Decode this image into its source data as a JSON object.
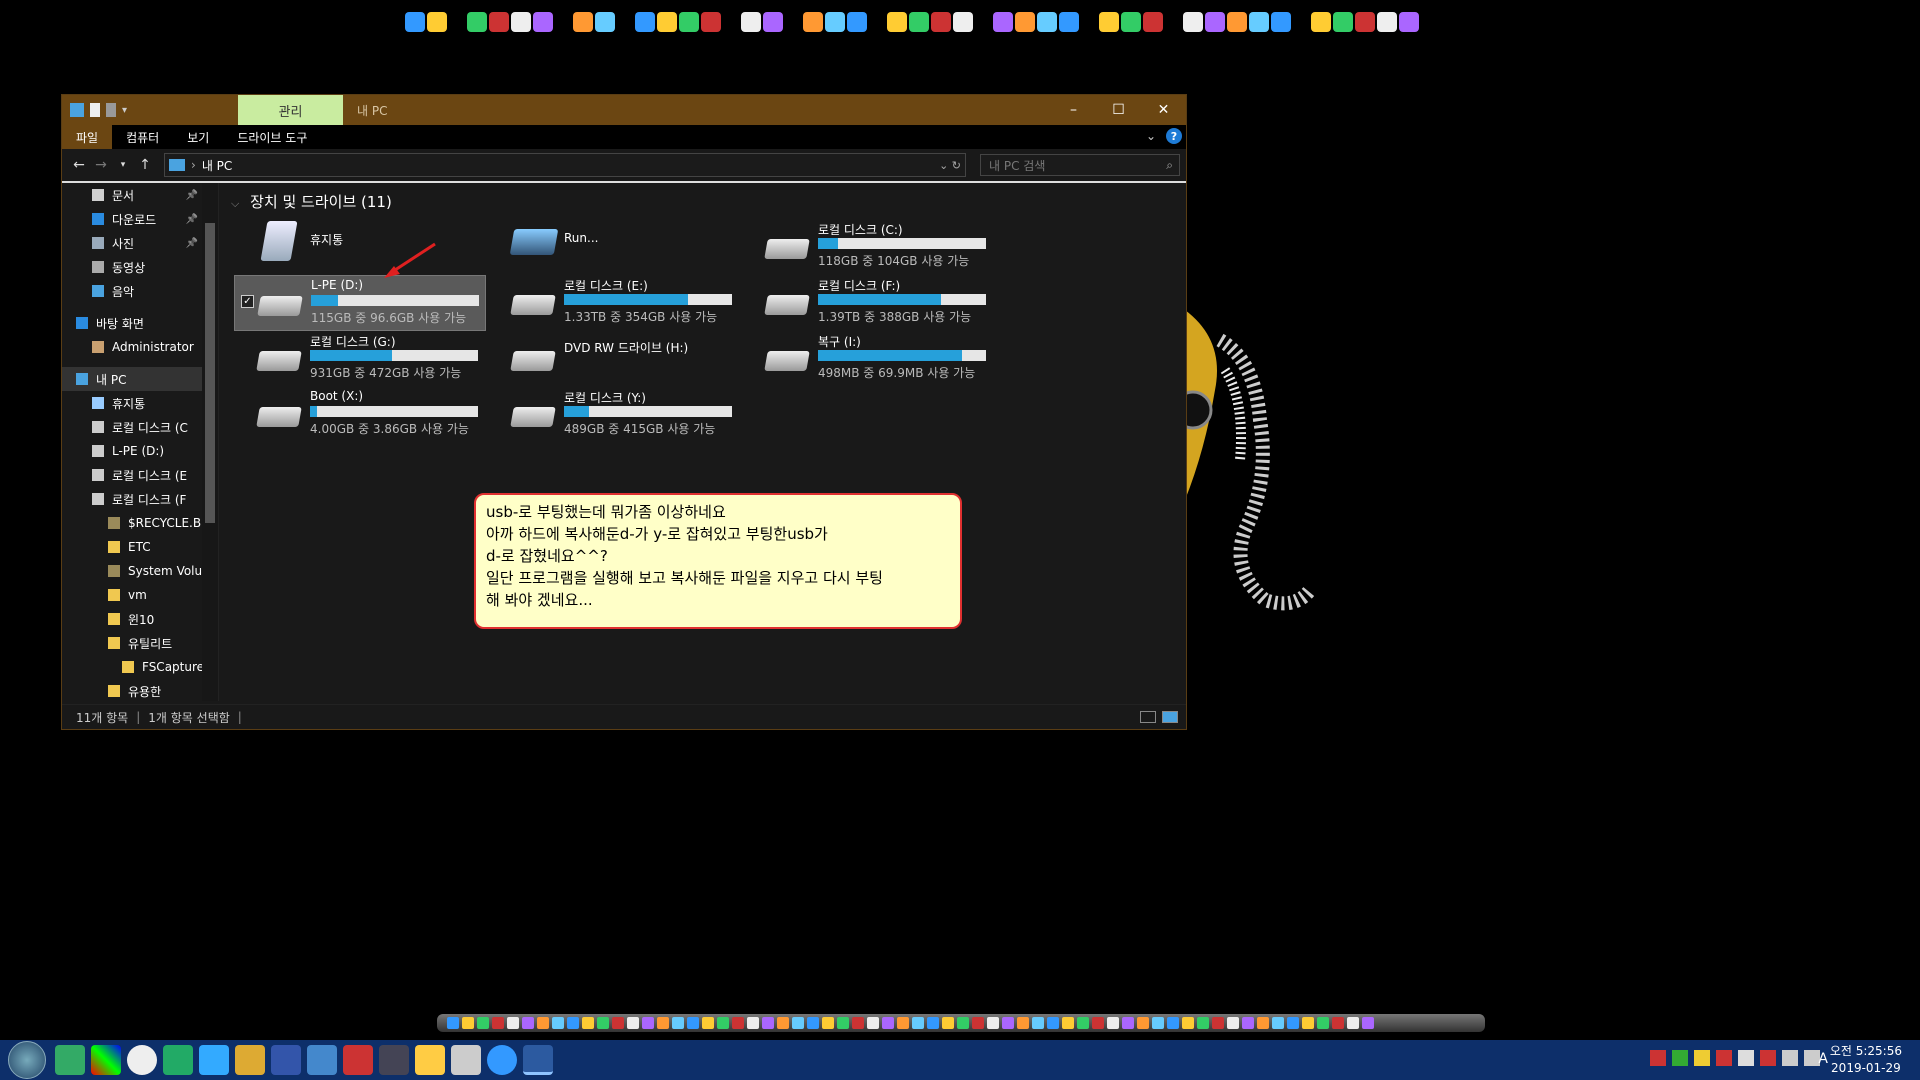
{
  "window": {
    "ribbon_context_tab": "관리",
    "title": "내 PC",
    "min_symbol": "–",
    "max_symbol": "☐",
    "close_symbol": "✕"
  },
  "ribbon": {
    "tabs": [
      "파일",
      "컴퓨터",
      "보기",
      "드라이브 도구"
    ],
    "help": "?"
  },
  "address": {
    "path": "내 PC",
    "search_placeholder": "내 PC 검색"
  },
  "nav": {
    "items": [
      {
        "label": "문서",
        "pinned": true,
        "color": "#cfcfcf"
      },
      {
        "label": "다운로드",
        "pinned": true,
        "color": "#2a8be0"
      },
      {
        "label": "사진",
        "pinned": true,
        "color": "#9ab"
      },
      {
        "label": "동영상",
        "pinned": false,
        "color": "#aaa"
      },
      {
        "label": "음악",
        "pinned": false,
        "color": "#4aa3e0"
      },
      {
        "label": "바탕 화면",
        "pinned": false,
        "color": "#2a8be0"
      },
      {
        "label": "Administrator",
        "pinned": false,
        "color": "#c9a070"
      },
      {
        "label": "내 PC",
        "pinned": false,
        "color": "#4aa3e0",
        "selected": true
      },
      {
        "label": "휴지통",
        "pinned": false,
        "color": "#9cf"
      },
      {
        "label": "로컬 디스크 (C",
        "pinned": false,
        "color": "#ccc"
      },
      {
        "label": "L-PE (D:)",
        "pinned": false,
        "color": "#ccc"
      },
      {
        "label": "로컬 디스크 (E",
        "pinned": false,
        "color": "#ccc"
      },
      {
        "label": "로컬 디스크 (F",
        "pinned": false,
        "color": "#ccc"
      },
      {
        "label": "$RECYCLE.BI",
        "pinned": false,
        "color": "#9a8a5a"
      },
      {
        "label": "ETC",
        "pinned": false,
        "color": "#f0c850"
      },
      {
        "label": "System Volu",
        "pinned": false,
        "color": "#9a8a5a"
      },
      {
        "label": "vm",
        "pinned": false,
        "color": "#f0c850"
      },
      {
        "label": "윈10",
        "pinned": false,
        "color": "#f0c850"
      },
      {
        "label": "유틸리트",
        "pinned": false,
        "color": "#f0c850"
      },
      {
        "label": "FSCapture v",
        "pinned": false,
        "color": "#f0c850"
      },
      {
        "label": "유용한",
        "pinned": false,
        "color": "#f0c850"
      }
    ]
  },
  "content": {
    "group_header": "장치 및 드라이브 (11)",
    "drives": [
      {
        "name": "휴지통",
        "sub": "",
        "used_fraction": null,
        "kind": "recycle"
      },
      {
        "name": "Run...",
        "sub": "",
        "used_fraction": null,
        "kind": "run"
      },
      {
        "name": "로컬 디스크 (C:)",
        "sub": "118GB 중 104GB 사용 가능",
        "used_fraction": 0.12,
        "kind": "disk"
      },
      {
        "name": "L-PE (D:)",
        "sub": "115GB 중 96.6GB 사용 가능",
        "used_fraction": 0.16,
        "kind": "disk",
        "selected": true
      },
      {
        "name": "로컬 디스크 (E:)",
        "sub": "1.33TB 중 354GB 사용 가능",
        "used_fraction": 0.74,
        "kind": "disk"
      },
      {
        "name": "로컬 디스크 (F:)",
        "sub": "1.39TB 중 388GB 사용 가능",
        "used_fraction": 0.73,
        "kind": "disk"
      },
      {
        "name": "로컬 디스크 (G:)",
        "sub": "931GB 중 472GB 사용 가능",
        "used_fraction": 0.49,
        "kind": "disk"
      },
      {
        "name": "DVD RW 드라이브 (H:)",
        "sub": "",
        "used_fraction": null,
        "kind": "dvd"
      },
      {
        "name": "복구 (I:)",
        "sub": "498MB 중 69.9MB 사용 가능",
        "used_fraction": 0.86,
        "kind": "disk"
      },
      {
        "name": "Boot (X:)",
        "sub": "4.00GB 중 3.86GB 사용 가능",
        "used_fraction": 0.04,
        "kind": "disk"
      },
      {
        "name": "로컬 디스크 (Y:)",
        "sub": "489GB 중 415GB 사용 가능",
        "used_fraction": 0.15,
        "kind": "disk"
      }
    ]
  },
  "note": {
    "line1": "usb-로 부팅했는데 뭐가좀 이상하네요",
    "line2": "아까 하드에 복사해둔d-가 y-로 잡혀있고 부팅한usb가",
    "line3": "d-로 잡혔네요^^?",
    "line4": "일단 프로그램을 실행해 보고 복사해둔 파일을 지우고 다시 부팅",
    "line5": "해 봐야 겠네요..."
  },
  "status": {
    "count": "11개 항목",
    "selected": "1개 항목 선택함"
  },
  "taskbar": {
    "lang": "A",
    "time": "오전 5:25:56",
    "date": "2019-01-29"
  },
  "colors": {
    "accent": "#6b4612",
    "context_tab": "#c9eca0",
    "bar_fill": "#26a0da",
    "note_border": "#e03030"
  }
}
